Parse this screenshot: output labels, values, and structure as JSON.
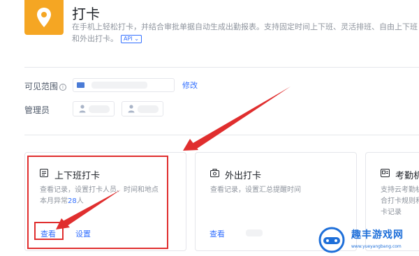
{
  "app": {
    "title": "打卡",
    "description": "在手机上轻松打卡，并结合审批单据自动生成出勤报表。支持固定时间上下班、灵活排班、自由上下班和外出打卡。",
    "api_badge": "API ⌄"
  },
  "settings": {
    "scope_label": "可见范围",
    "scope_edit": "修改",
    "admin_label": "管理员"
  },
  "cards": [
    {
      "title": "上下班打卡",
      "desc_line1": "查看记录，设置打卡人员、时间和地点",
      "desc_prefix": "本月异常",
      "desc_count": "28",
      "desc_suffix": "人",
      "view": "查看",
      "settings": "设置"
    },
    {
      "title": "外出打卡",
      "desc_line1": "查看记录，设置汇总提醒时间",
      "view": "查看"
    },
    {
      "title": "考勤机",
      "desc_line1": "支持云考勤机",
      "desc_line2": "合打卡规则和",
      "desc_line3": "卡记录"
    }
  ],
  "watermark": {
    "title": "趣丰游戏网",
    "url": "www.yueyangbang.com"
  },
  "colors": {
    "accent": "#3370ff",
    "app_icon": "#f5a623",
    "annotation": "#e02e2e"
  },
  "icons": [
    "location-pin-icon",
    "info-icon",
    "folder-icon",
    "person-icon",
    "list-icon",
    "camera-icon",
    "device-icon"
  ]
}
